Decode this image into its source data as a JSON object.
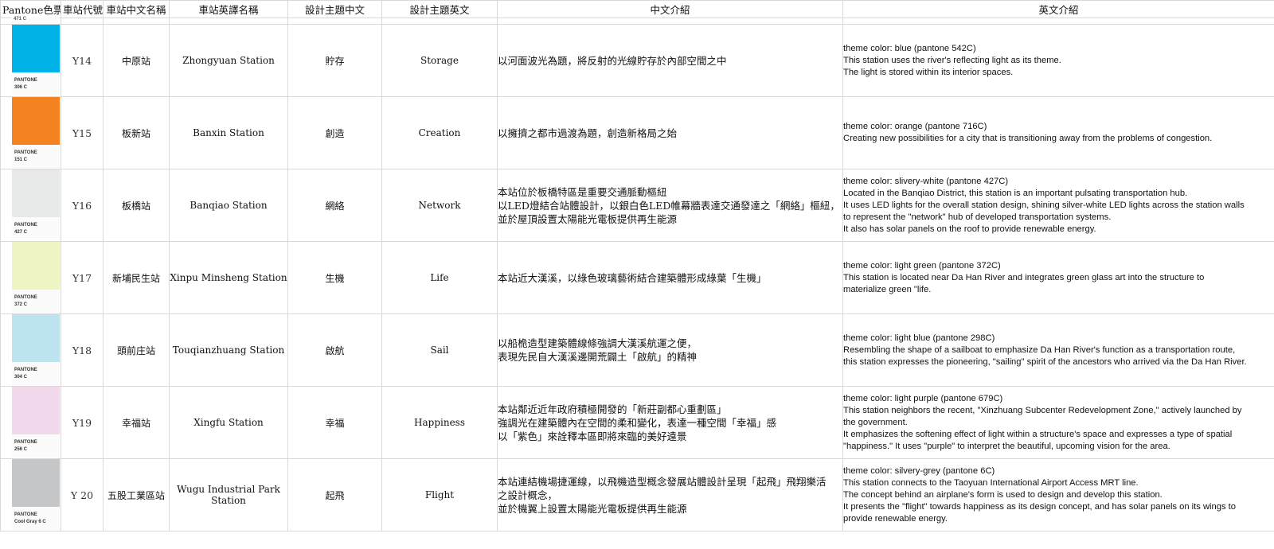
{
  "headers": [
    "Pantone色票",
    "車站代號",
    "車站中文名稱",
    "車站英譯名稱",
    "設計主題中文",
    "設計主題英文",
    "中文介紹",
    "英文介紹"
  ],
  "top_swatch_peek": "471 C",
  "swatch_brand": "PANTONE",
  "rows": [
    {
      "swatch_code": "306 C",
      "swatch_color": "#00b3e6",
      "code": "Y14",
      "name_zh": "中原站",
      "name_en": "Zhongyuan Station",
      "theme_zh": "貯存",
      "theme_en": "Storage",
      "desc_zh": [
        "以河面波光為題，將反射的光線貯存於內部空間之中"
      ],
      "desc_en": [
        "theme color: blue (pantone 542C)",
        "This station uses the river's reflecting light as its theme.",
        "The light is stored within its interior spaces."
      ]
    },
    {
      "swatch_code": "151 C",
      "swatch_color": "#f58220",
      "code": "Y15",
      "name_zh": "板新站",
      "name_en": "Banxin Station",
      "theme_zh": "創造",
      "theme_en": "Creation",
      "desc_zh": [
        "以擁擠之都市過渡為題，創造新格局之始"
      ],
      "desc_en": [
        " theme color: orange (pantone 716C)",
        " Creating new possibilities for a city that is transitioning away from the problems of congestion."
      ]
    },
    {
      "swatch_code": "427 C",
      "swatch_color": "#e7e8e8",
      "code": "Y16",
      "name_zh": "板橋站",
      "name_en": "Banqiao Station",
      "theme_zh": "網絡",
      "theme_en": "Network",
      "desc_zh": [
        "本站位於板橋特區是重要交通脈動樞紐",
        "以LED燈結合站體設計，以銀白色LED帷幕牆表達交通發達之「網絡」樞紐，",
        "並於屋頂設置太陽能光電板提供再生能源"
      ],
      "desc_en": [
        "theme color: slivery-white (pantone 427C)",
        " Located in the Banqiao District, this station is an important pulsating transportation hub.",
        "It uses LED lights for the overall station design, shining silver-white LED lights across the station walls",
        "to represent the \"network\" hub of developed transportation systems.",
        "It also has solar panels on the roof to provide renewable energy."
      ]
    },
    {
      "swatch_code": "372 C",
      "swatch_color": "#eef4c2",
      "code": "Y17",
      "name_zh": "新埔民生站",
      "name_en": "Xinpu Minsheng Station",
      "theme_zh": "生機",
      "theme_en": "Life",
      "desc_zh": [
        "本站近大漢溪，以綠色玻璃藝術結合建築體形成綠葉「生機」"
      ],
      "desc_en": [
        "theme color: light green (pantone 372C)",
        "This station is located near Da Han River and integrates green glass art into the structure to",
        "materialize green \"life."
      ]
    },
    {
      "swatch_code": "304 C",
      "swatch_color": "#bde3ee",
      "code": "Y18",
      "name_zh": "頭前庄站",
      "name_en": "Touqianzhuang Station",
      "theme_zh": "啟航",
      "theme_en": "Sail",
      "desc_zh": [
        "以船桅造型建築體線條強調大漢溪航運之便，",
        "表現先民自大漢溪邊開荒闢土「啟航」的精神"
      ],
      "desc_en": [
        "theme color: light blue (pantone 298C)",
        "Resembling the shape of a sailboat to emphasize Da Han River's function as a transportation route,",
        "this station expresses the pioneering, \"sailing\" spirit of the ancestors who arrived via the Da Han River."
      ]
    },
    {
      "swatch_code": "256 C",
      "swatch_color": "#f1d8ea",
      "code": "Y19",
      "name_zh": "幸福站",
      "name_en": "Xingfu Station",
      "theme_zh": "幸福",
      "theme_en": "Happiness",
      "desc_zh": [
        "本站鄰近近年政府積極開發的「新莊副都心重劃區」",
        "強調光在建築體內在空間的柔和變化，表達一種空間「幸福」感",
        "以「紫色」來詮釋本區即將來臨的美好遠景"
      ],
      "desc_en": [
        "theme color: light purple (pantone 679C)",
        "This station neighbors the recent, \"Xinzhuang Subcenter Redevelopment Zone,\" actively launched by",
        "the government.",
        "It emphasizes the softening effect of light within a structure's space and expresses a type of spatial",
        "\"happiness.\"  It uses \"purple\" to interpret the beautiful, upcoming vision for the area."
      ]
    },
    {
      "swatch_code": "Cool Gray 6 C",
      "swatch_color": "#c4c6c8",
      "code": "Y 20",
      "name_zh": "五股工業區站",
      "name_en": "Wugu Industrial Park  Station",
      "theme_zh": "起飛",
      "theme_en": "Flight",
      "desc_zh": [
        "本站連結機場捷運線，以飛機造型概念發展站體設計呈現「起飛」飛翔樂活",
        "之設計概念，",
        "並於機翼上設置太陽能光電板提供再生能源"
      ],
      "desc_en": [
        "theme color: silvery-grey (pantone 6C)",
        "This station connects to the Taoyuan International Airport Access MRT line.",
        "The concept behind an airplane's form is used to design and develop this station.",
        "It presents the \"flight\" towards happiness as its design concept, and has solar panels on its wings to",
        "provide renewable energy."
      ]
    }
  ]
}
